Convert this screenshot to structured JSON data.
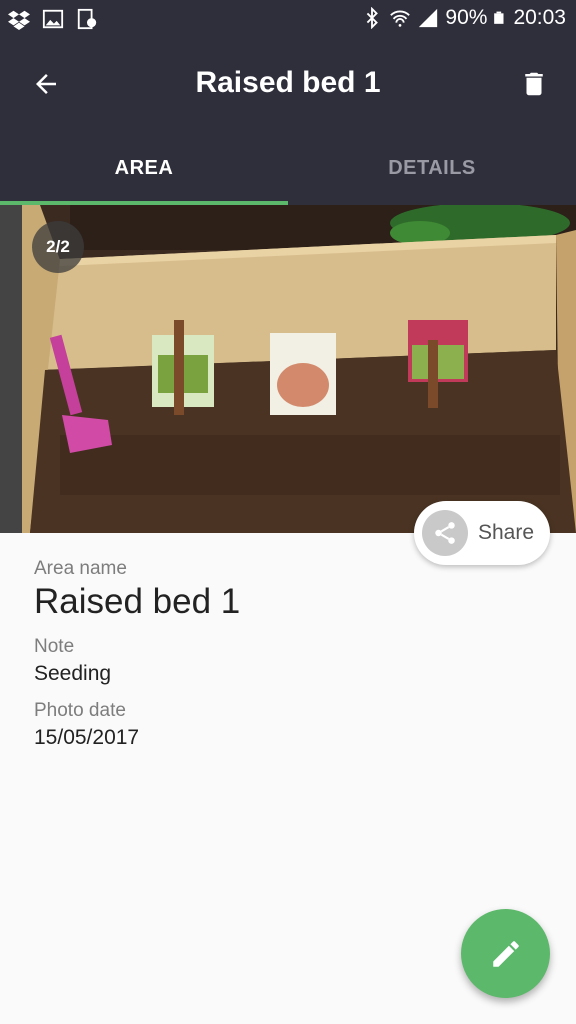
{
  "status_bar": {
    "left_icons": [
      "dropbox-icon",
      "image-icon",
      "screenshot-icon"
    ],
    "right_icons": [
      "bluetooth-icon",
      "wifi-icon",
      "signal-icon",
      "battery-icon"
    ],
    "battery": "90%",
    "time": "20:03"
  },
  "app_bar": {
    "title": "Raised bed 1",
    "back_icon": "arrow-back-icon",
    "delete_icon": "trash-icon"
  },
  "tabs": [
    {
      "label": "AREA",
      "selected": true
    },
    {
      "label": "DETAILS",
      "selected": false
    }
  ],
  "photo": {
    "counter": "2/2"
  },
  "share": {
    "label": "Share",
    "icon": "share-icon"
  },
  "details": {
    "area_name_label": "Area name",
    "area_name": "Raised bed 1",
    "note_label": "Note",
    "note": "Seeding",
    "photo_date_label": "Photo date",
    "photo_date": "15/05/2017"
  },
  "fab": {
    "icon": "edit-pencil-icon"
  },
  "colors": {
    "primary_dark": "#2f2f3c",
    "accent": "#5cb86a",
    "background": "#fafafa"
  }
}
